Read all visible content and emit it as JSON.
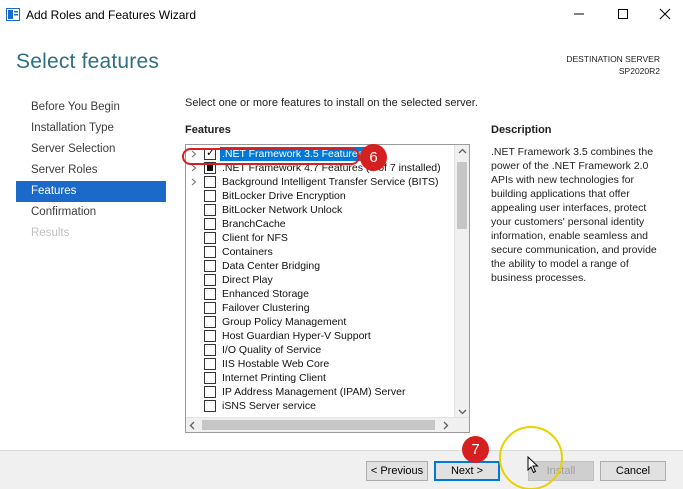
{
  "window": {
    "title": "Add Roles and Features Wizard",
    "icon": "server-manager-icon"
  },
  "page": {
    "title": "Select features",
    "destination_label": "DESTINATION SERVER",
    "destination_server": "SP2020R2"
  },
  "nav": {
    "items": [
      {
        "label": "Before You Begin",
        "state": "normal"
      },
      {
        "label": "Installation Type",
        "state": "normal"
      },
      {
        "label": "Server Selection",
        "state": "normal"
      },
      {
        "label": "Server Roles",
        "state": "normal"
      },
      {
        "label": "Features",
        "state": "active"
      },
      {
        "label": "Confirmation",
        "state": "normal"
      },
      {
        "label": "Results",
        "state": "disabled"
      }
    ]
  },
  "content": {
    "instruction": "Select one or more features to install on the selected server.",
    "features_heading": "Features",
    "description_heading": "Description",
    "description_text": ".NET Framework 3.5 combines the power of the .NET Framework 2.0 APIs with new technologies for building applications that offer appealing user interfaces, protect your customers' personal identity information, enable seamless and secure communication, and provide the ability to model a range of business processes."
  },
  "features": [
    {
      "label": ".NET Framework 3.5 Features",
      "checked": "checked",
      "expandable": true,
      "selected": true
    },
    {
      "label": ".NET Framework 4.7 Features (3 of 7 installed)",
      "checked": "partial",
      "expandable": true,
      "selected": false
    },
    {
      "label": "Background Intelligent Transfer Service (BITS)",
      "checked": "none",
      "expandable": true,
      "selected": false
    },
    {
      "label": "BitLocker Drive Encryption",
      "checked": "none",
      "expandable": false,
      "selected": false
    },
    {
      "label": "BitLocker Network Unlock",
      "checked": "none",
      "expandable": false,
      "selected": false
    },
    {
      "label": "BranchCache",
      "checked": "none",
      "expandable": false,
      "selected": false
    },
    {
      "label": "Client for NFS",
      "checked": "none",
      "expandable": false,
      "selected": false
    },
    {
      "label": "Containers",
      "checked": "none",
      "expandable": false,
      "selected": false
    },
    {
      "label": "Data Center Bridging",
      "checked": "none",
      "expandable": false,
      "selected": false
    },
    {
      "label": "Direct Play",
      "checked": "none",
      "expandable": false,
      "selected": false
    },
    {
      "label": "Enhanced Storage",
      "checked": "none",
      "expandable": false,
      "selected": false
    },
    {
      "label": "Failover Clustering",
      "checked": "none",
      "expandable": false,
      "selected": false
    },
    {
      "label": "Group Policy Management",
      "checked": "none",
      "expandable": false,
      "selected": false
    },
    {
      "label": "Host Guardian Hyper-V Support",
      "checked": "none",
      "expandable": false,
      "selected": false
    },
    {
      "label": "I/O Quality of Service",
      "checked": "none",
      "expandable": false,
      "selected": false
    },
    {
      "label": "IIS Hostable Web Core",
      "checked": "none",
      "expandable": false,
      "selected": false
    },
    {
      "label": "Internet Printing Client",
      "checked": "none",
      "expandable": false,
      "selected": false
    },
    {
      "label": "IP Address Management (IPAM) Server",
      "checked": "none",
      "expandable": false,
      "selected": false
    },
    {
      "label": "iSNS Server service",
      "checked": "none",
      "expandable": false,
      "selected": false
    }
  ],
  "buttons": {
    "previous": "< Previous",
    "next": "Next >",
    "install": "Install",
    "cancel": "Cancel"
  },
  "annotations": {
    "step_6": "6",
    "step_7": "7"
  },
  "colors": {
    "accent": "#1b6ac9",
    "title": "#2e6f86",
    "selection": "#0078d7",
    "badge": "#d62020",
    "cursor_ring": "#e8d100"
  }
}
